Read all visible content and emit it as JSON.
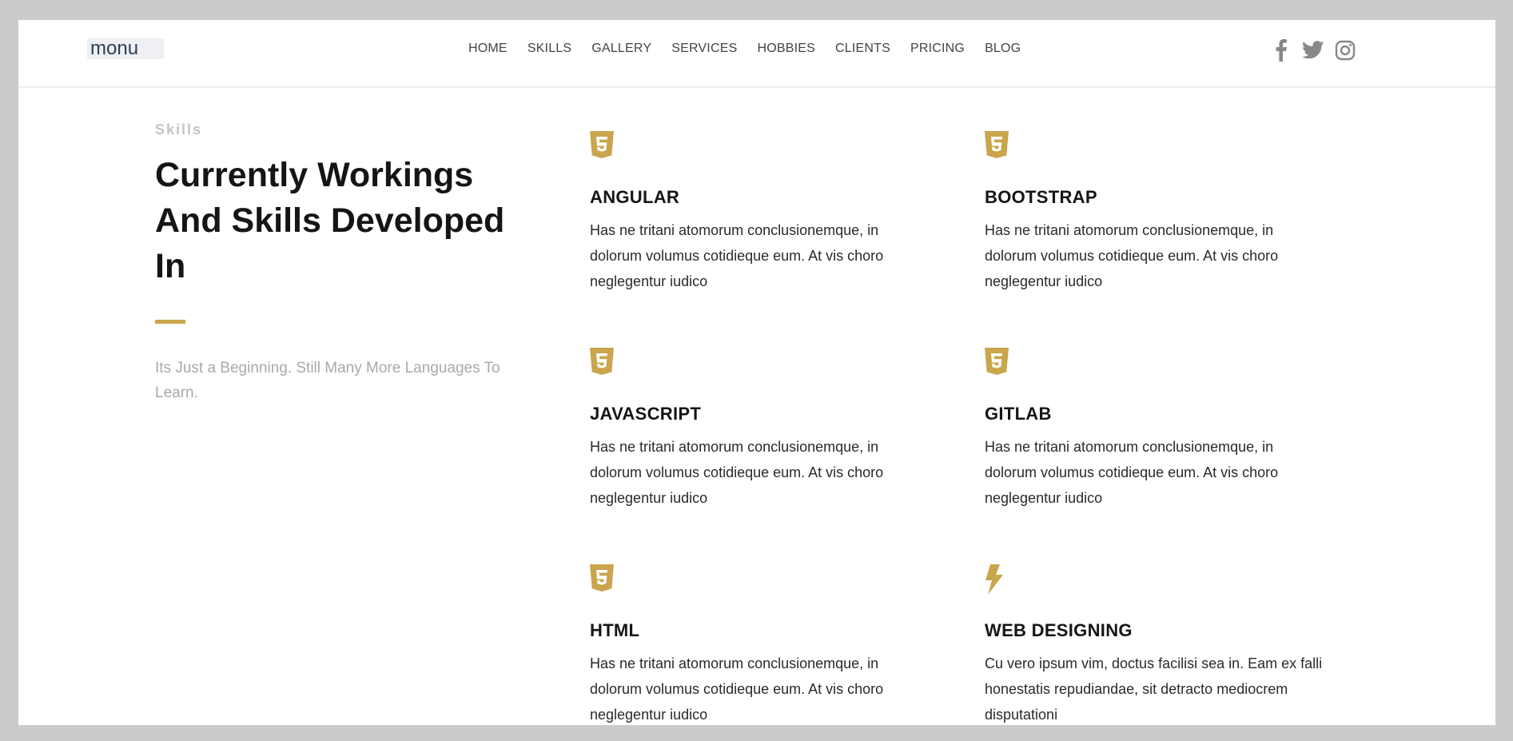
{
  "brand": {
    "logo_text": "monu"
  },
  "nav": {
    "items": [
      {
        "label": "HOME"
      },
      {
        "label": "SKILLS"
      },
      {
        "label": "GALLERY"
      },
      {
        "label": "SERVICES"
      },
      {
        "label": "HOBBIES"
      },
      {
        "label": "CLIENTS"
      },
      {
        "label": "PRICING"
      },
      {
        "label": "BLOG"
      }
    ]
  },
  "social": {
    "icons": [
      "facebook-icon",
      "twitter-icon",
      "instagram-icon"
    ]
  },
  "skills_section": {
    "eyebrow": "Skills",
    "headline": "Currently Workings And Skills Developed In",
    "subtext": "Its Just a Beginning. Still Many More Languages To Learn."
  },
  "skills": [
    {
      "icon": "html5-icon",
      "title": "ANGULAR",
      "text": "Has ne tritani atomorum conclusionemque, in dolorum volumus cotidieque eum. At vis choro neglegentur iudico"
    },
    {
      "icon": "html5-icon",
      "title": "BOOTSTRAP",
      "text": "Has ne tritani atomorum conclusionemque, in dolorum volumus cotidieque eum. At vis choro neglegentur iudico"
    },
    {
      "icon": "html5-icon",
      "title": "JAVASCRIPT",
      "text": "Has ne tritani atomorum conclusionemque, in dolorum volumus cotidieque eum. At vis choro neglegentur iudico"
    },
    {
      "icon": "html5-icon",
      "title": "GITLAB",
      "text": "Has ne tritani atomorum conclusionemque, in dolorum volumus cotidieque eum. At vis choro neglegentur iudico"
    },
    {
      "icon": "html5-icon",
      "title": "HTML",
      "text": "Has ne tritani atomorum conclusionemque, in dolorum volumus cotidieque eum. At vis choro neglegentur iudico"
    },
    {
      "icon": "bolt-icon",
      "title": "WEB DESIGNING",
      "text": "Cu vero ipsum vim, doctus facilisi sea in. Eam ex falli honestatis repudiandae, sit detracto mediocrem disputationi"
    }
  ],
  "colors": {
    "accent": "#c9a54c",
    "heading": "#151515",
    "muted": "#a9a9a9",
    "nav_text": "#444444",
    "social_icons": "#888888",
    "logo_text": "#2d3e55"
  }
}
